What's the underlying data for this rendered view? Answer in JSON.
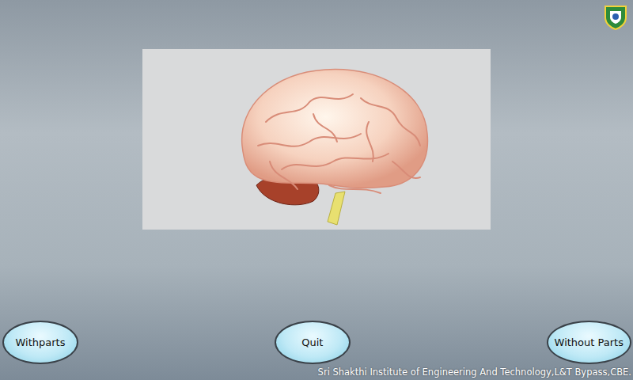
{
  "buttons": [
    {
      "label": "Withparts"
    },
    {
      "label": "Quit"
    },
    {
      "label": "Without Parts"
    }
  ],
  "footer": "Sri Shakthi Institute of Engineering And Technology,L&T Bypass,CBE."
}
